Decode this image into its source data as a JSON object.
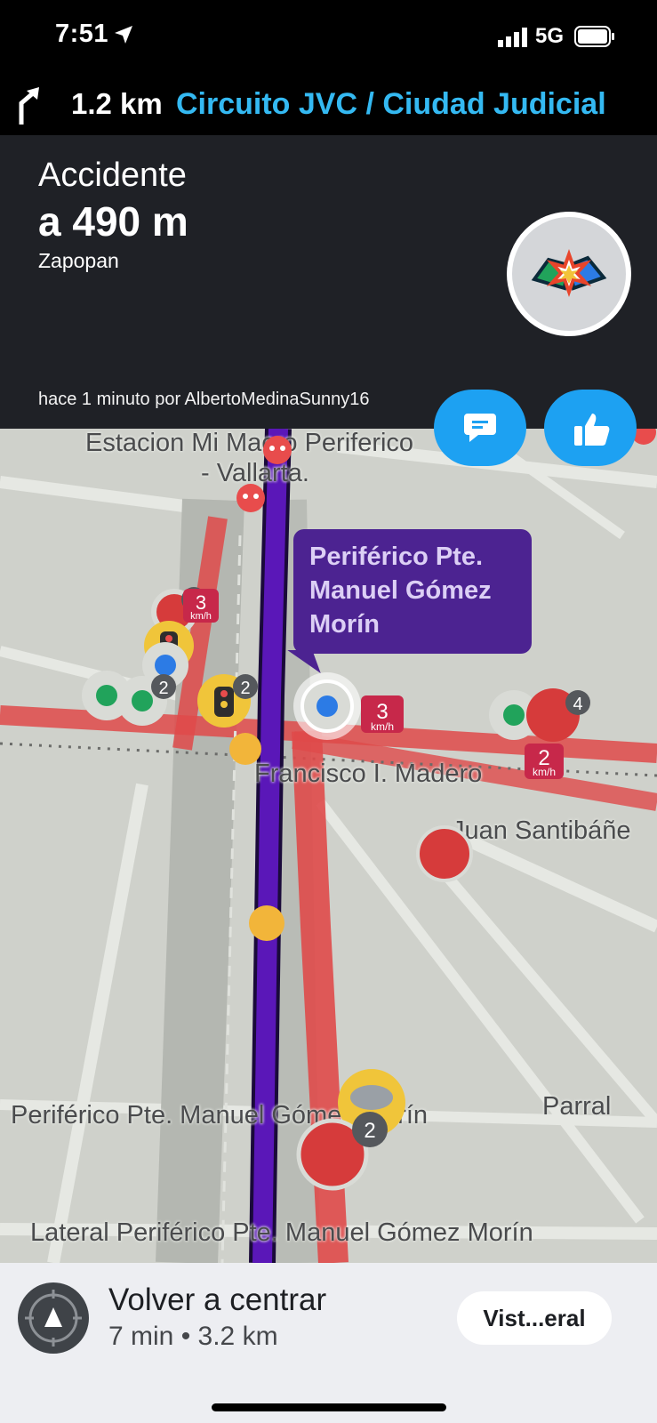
{
  "status_bar": {
    "time": "7:51",
    "network": "5G"
  },
  "navigation": {
    "distance": "1.2 km",
    "street": "Circuito JVC / Ciudad Judicial"
  },
  "alert": {
    "type": "Accidente",
    "distance": "a 490 m",
    "city": "Zapopan",
    "reporter": "hace 1 minuto por AlbertoMedinaSunny16",
    "icon": "accident-icon"
  },
  "map": {
    "labels": {
      "station": "Estacion Mi Macro Periferico",
      "station2": "- Vallarta.",
      "madero": "Francisco I. Madero",
      "santibanez": "Juan Santibáñe",
      "periferico": "Periférico Pte. Manuel Gómez Morín",
      "parral": "Parral",
      "lateral": "Lateral Periférico Pte. Manuel Gómez Morín"
    },
    "callout_lines": [
      "Periférico Pte.",
      "Manuel Gómez",
      "Morín"
    ],
    "speed_badges": [
      {
        "value": "3",
        "unit": "km/h"
      },
      {
        "value": "2",
        "unit": "km/h"
      },
      {
        "value": "3",
        "unit": "km/h"
      }
    ],
    "counts": [
      "3",
      "2",
      "2",
      "4",
      "2"
    ],
    "colors": {
      "route": "#5a17b8",
      "traffic": "#e24a4a",
      "accent": "#1da1f2"
    }
  },
  "bottom": {
    "title": "Volver a centrar",
    "eta": "7 min • 3.2 km",
    "overview_label": "Vist...eral"
  }
}
